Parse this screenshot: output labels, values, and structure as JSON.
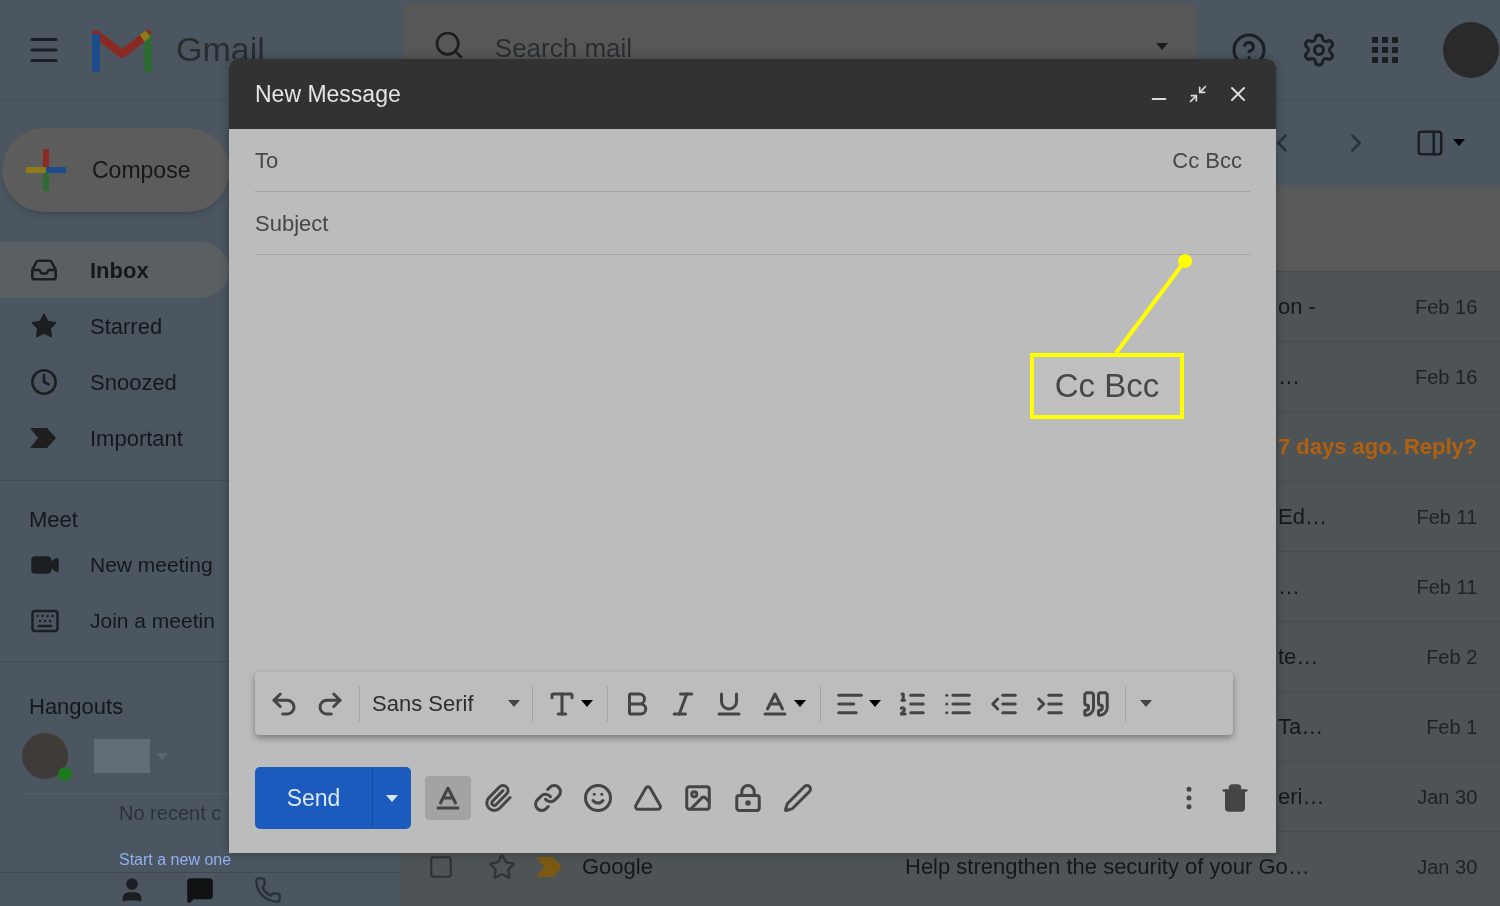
{
  "header": {
    "app_name": "Gmail",
    "search": {
      "placeholder": "Search mail"
    }
  },
  "compose_button": {
    "label": "Compose"
  },
  "sidebar": {
    "items": [
      {
        "label": "Inbox",
        "selected": true
      },
      {
        "label": "Starred",
        "selected": false
      },
      {
        "label": "Snoozed",
        "selected": false
      },
      {
        "label": "Important",
        "selected": false
      }
    ]
  },
  "meet": {
    "title": "Meet",
    "items": [
      {
        "label": "New meeting"
      },
      {
        "label": "Join a meetin"
      }
    ]
  },
  "hangouts": {
    "title": "Hangouts",
    "empty_text": "No recent c",
    "link": "Start a new one"
  },
  "message_list": {
    "rows": [
      {
        "kind": "partial",
        "snippet": "on -",
        "date": "Feb 16"
      },
      {
        "kind": "partial",
        "snippet": "…",
        "date": "Feb 16"
      },
      {
        "kind": "nudge",
        "snippet": "7 days ago. Reply?"
      },
      {
        "kind": "partial",
        "snippet": "Ed…",
        "date": "Feb 11"
      },
      {
        "kind": "partial",
        "snippet": "…",
        "date": "Feb 11"
      },
      {
        "kind": "partial",
        "snippet": "te…",
        "date": "Feb 2"
      },
      {
        "kind": "partial",
        "snippet": "Ta…",
        "date": "Feb 1"
      },
      {
        "kind": "partial",
        "snippet": "eri…",
        "date": "Jan 30"
      },
      {
        "kind": "full",
        "sender": "Google",
        "snippet": "Help strengthen the security of your Go…",
        "date": "Jan 30",
        "checked": false,
        "starred": false,
        "important": true
      }
    ]
  },
  "compose": {
    "title": "New Message",
    "fields": [
      {
        "label": "To"
      },
      {
        "label": "Subject"
      }
    ],
    "cc_bcc": "Cc Bcc",
    "callout": {
      "label": "Cc Bcc"
    },
    "font": "Sans Serif",
    "formatting_options": {
      "selected": true
    },
    "send": "Send"
  }
}
